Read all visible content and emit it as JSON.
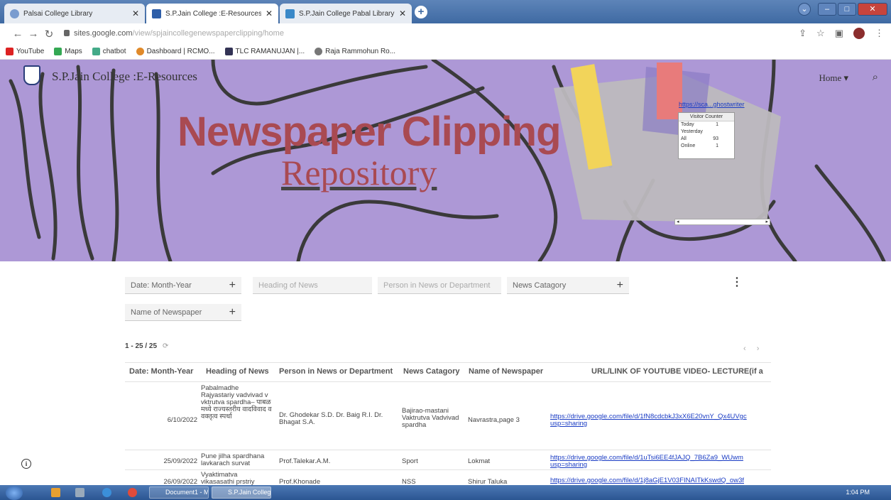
{
  "browser": {
    "tabs": [
      {
        "label": "Palsai College Library",
        "color": "#7a9ccf"
      },
      {
        "label": "S.P.Jain College :E-Resources",
        "color": "#2e5ea8"
      },
      {
        "label": "S.P.Jain College Pabal Library Pr...",
        "color": "#3a89c8"
      }
    ],
    "new_tab": "+",
    "url_host": "sites.google.com",
    "url_path": "/view/spjaincollegenewspaperclipping/home",
    "bookmarks": [
      {
        "label": "YouTube",
        "color": "#d22"
      },
      {
        "label": "Maps",
        "color": "#34a853"
      },
      {
        "label": "chatbot",
        "color": "#4a8"
      },
      {
        "label": "Dashboard | RCMO...",
        "color": "#e08a2a"
      },
      {
        "label": "TLC RAMANUJAN |...",
        "color": "#335"
      },
      {
        "label": "Raja Rammohun Ro...",
        "color": "#777"
      }
    ]
  },
  "site": {
    "title": "S.P.Jain College :E-Resources",
    "nav_home": "Home ▾",
    "hero_line1": "Newspaper Clipping",
    "hero_line2": "Repository",
    "visitor_link": "https://sca...ghostwriter",
    "counter": {
      "header": "Visitor Counter",
      "rows": [
        {
          "label": "Today",
          "value": "1"
        },
        {
          "label": "Yesterday",
          "value": ""
        },
        {
          "label": "All",
          "value": "93"
        },
        {
          "label": "Online",
          "value": "1"
        }
      ]
    }
  },
  "filters": {
    "date": "Date: Month-Year",
    "heading": "Heading of News",
    "person": "Person in News or Department",
    "category": "News Catagory",
    "newspaper": "Name of Newspaper",
    "plus": "+",
    "more": "⋮"
  },
  "count": {
    "label": "1 - 25 / 25",
    "refresh": "⟳"
  },
  "pager": "‹ ›",
  "table": {
    "headers": [
      "Date: Month-Year",
      "Heading of News",
      "Person in News or Department",
      "News Catagory",
      "Name of Newspaper",
      "URL/LINK OF YOUTUBE VIDEO- LECTURE(if a"
    ],
    "rows": [
      {
        "date": "6/10/2022",
        "heading": "Pabalmadhe Rajyastariy vadvivad v vktrutva spardha– पाबळ मध्ये राज्यस्तरीय वादविवाद व वक्तृत्व स्पर्धा",
        "person": "Dr. Ghodekar S.D. Dr. Baig R.I. Dr. Bhagat S.A.",
        "category": "Bajirao-mastani Vaktrutva Vadvivad spardha",
        "newspaper": "Navrastra,page 3",
        "link": "https://drive.google.com/file/d/1fN8cdcbkJ3xX6E20vnY_Qx4UVgc usp=sharing"
      },
      {
        "date": "25/09/2022",
        "heading": "Pune jilha spardhana lavkarach survat",
        "person": "Prof.Talekar.A.M.",
        "category": "Sport",
        "newspaper": "Lokmat",
        "link": "https://drive.google.com/file/d/1uTsi6EE4fJAJQ_7B6Za9_WUwm usp=sharing"
      },
      {
        "date": "26/09/2022",
        "heading": "Vyaktimatva vikasasathi prstriy",
        "person": "Prof.Khonade",
        "category": "NSS",
        "newspaper": "Shirur Taluka",
        "link": "https://drive.google.com/file/d/1j8aGjE1V03FINAITkKswdQ_ow3f"
      }
    ]
  },
  "taskbar": {
    "items": [
      "Document1 - Micros...",
      "S.P.Jain College :E-R..."
    ],
    "clock": "1:04 PM"
  }
}
